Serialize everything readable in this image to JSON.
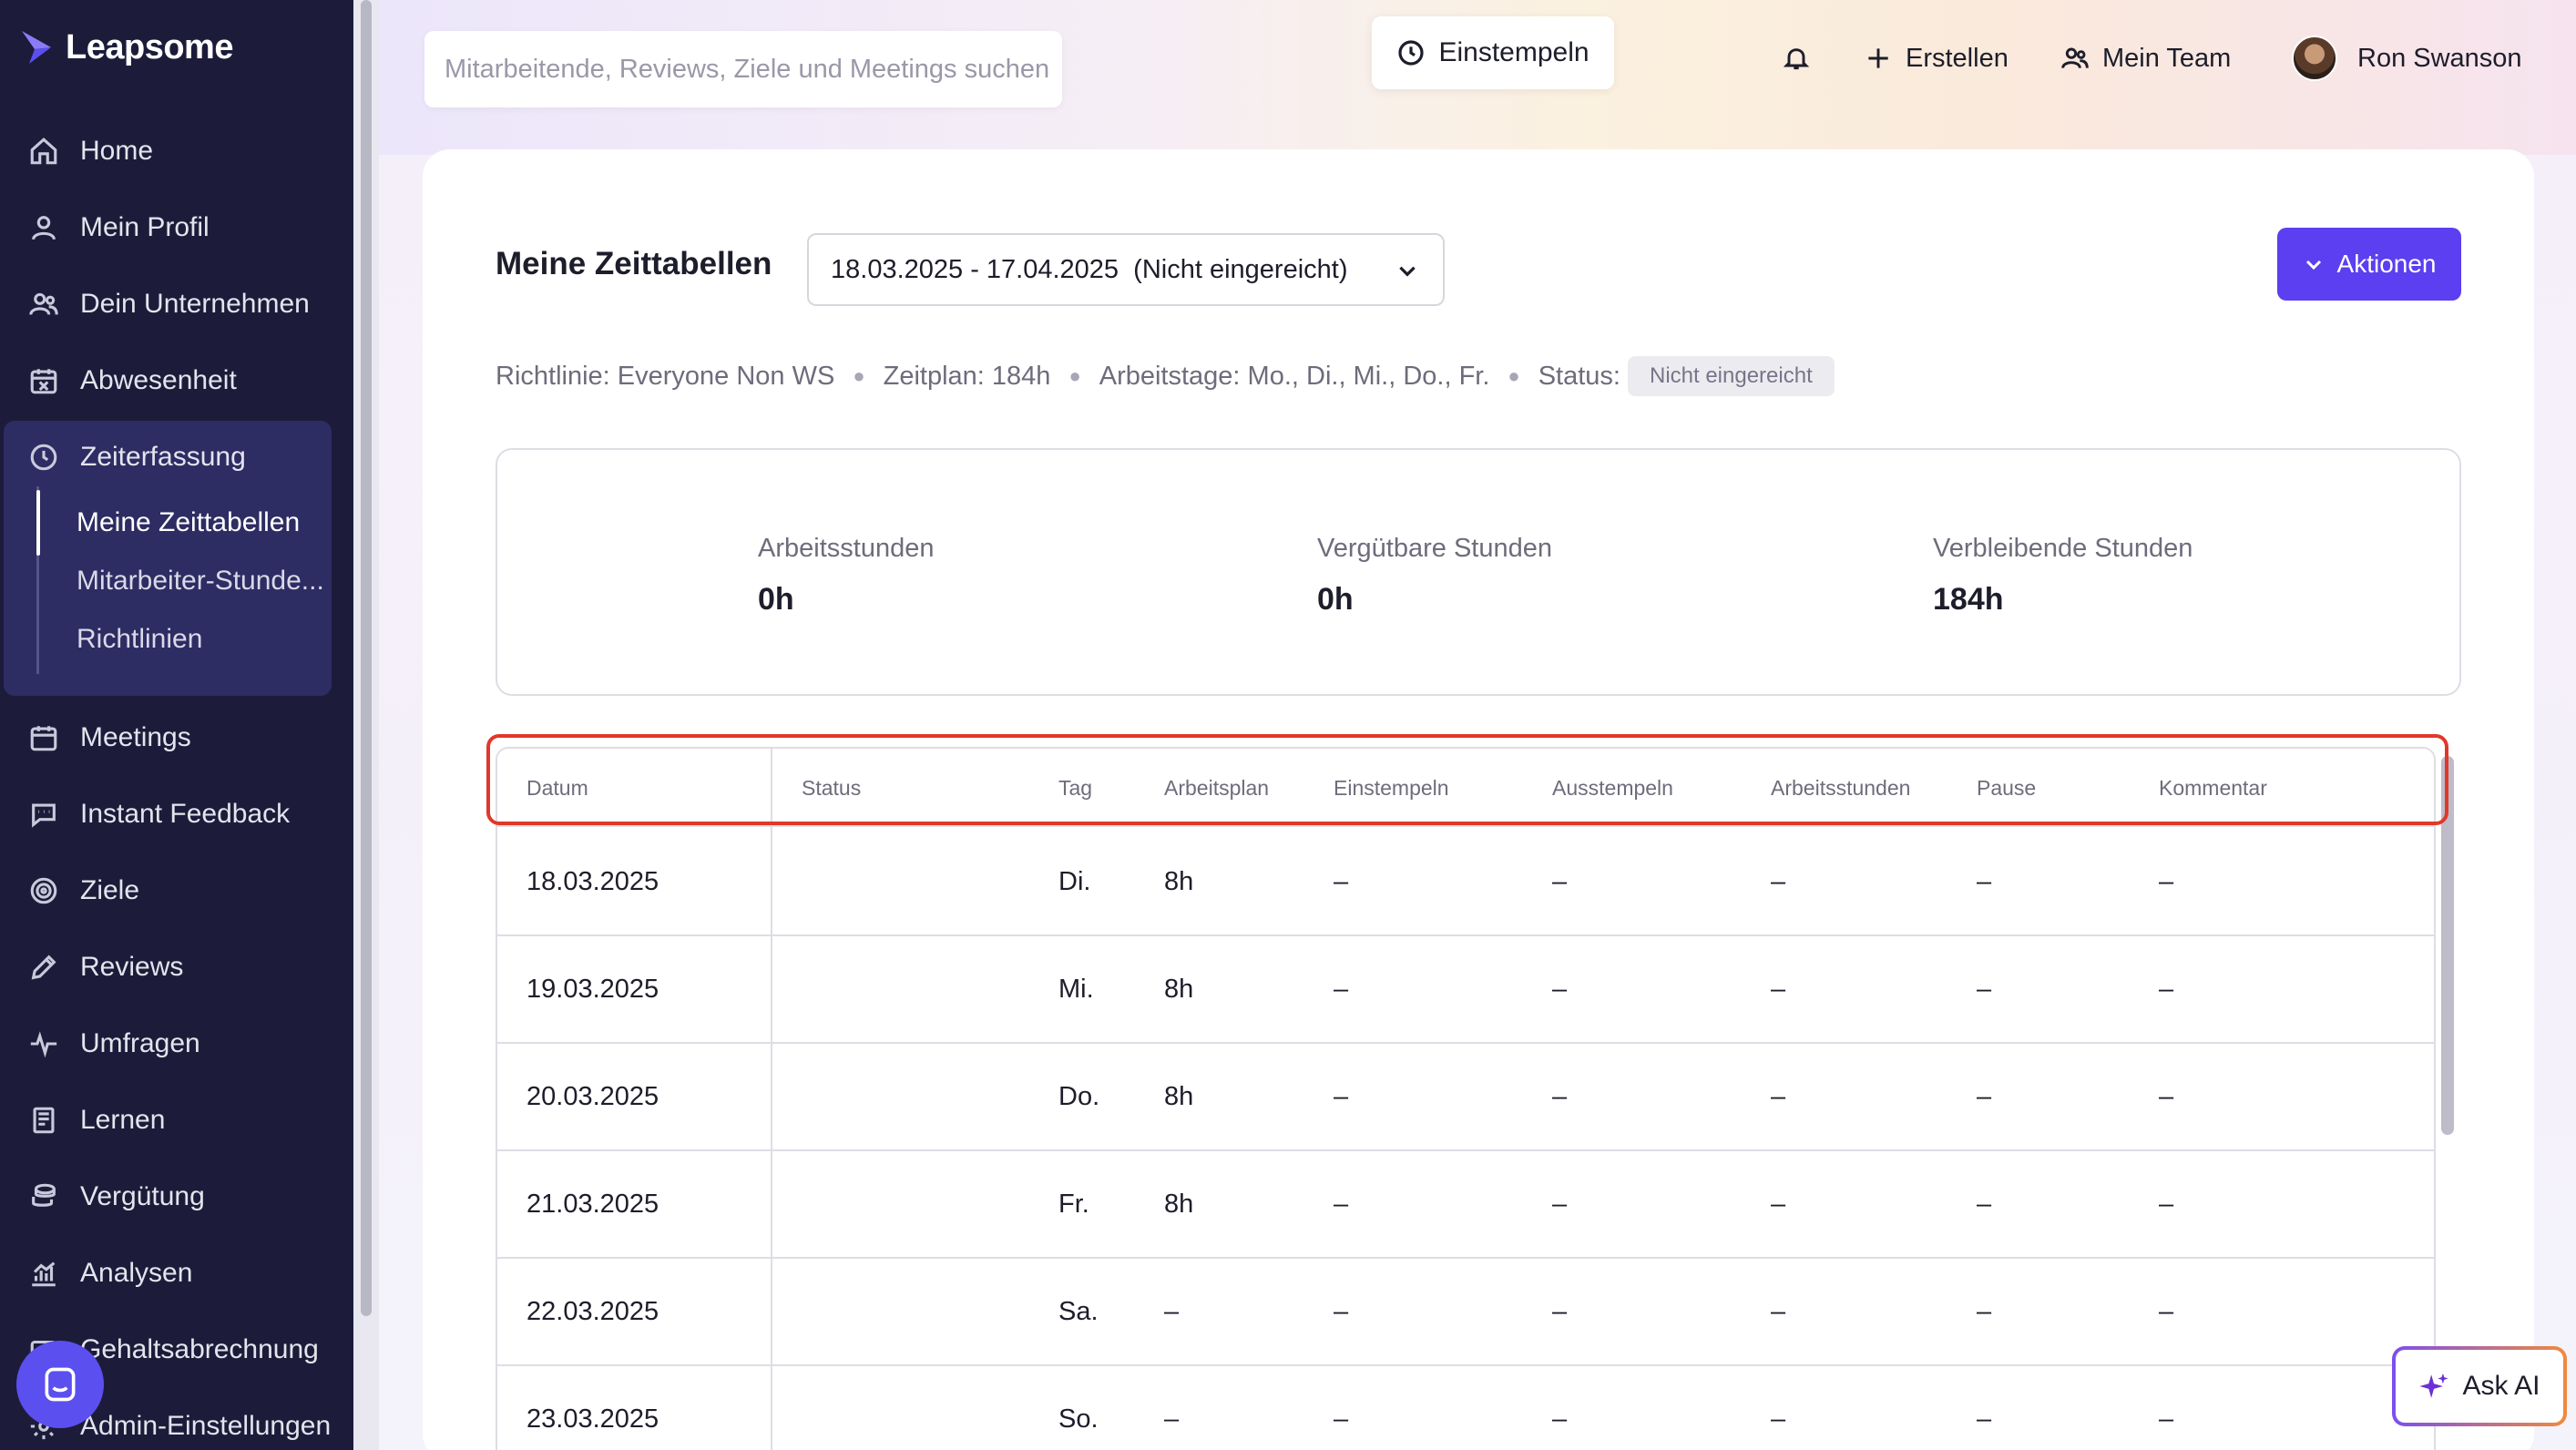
{
  "app": {
    "logo_text": "Leapsome"
  },
  "sidebar": {
    "items": [
      {
        "label": "Home",
        "icon": "home-icon"
      },
      {
        "label": "Mein Profil",
        "icon": "user-icon"
      },
      {
        "label": "Dein Unternehmen",
        "icon": "people-icon"
      },
      {
        "label": "Abwesenheit",
        "icon": "calendar-x-icon"
      },
      {
        "label": "Zeiterfassung",
        "icon": "clock-icon"
      },
      {
        "label": "Meetings",
        "icon": "calendar-icon"
      },
      {
        "label": "Instant Feedback",
        "icon": "chat-icon"
      },
      {
        "label": "Ziele",
        "icon": "target-icon"
      },
      {
        "label": "Reviews",
        "icon": "pencil-icon"
      },
      {
        "label": "Umfragen",
        "icon": "pulse-icon"
      },
      {
        "label": "Lernen",
        "icon": "book-icon"
      },
      {
        "label": "Vergütung",
        "icon": "coins-icon"
      },
      {
        "label": "Analysen",
        "icon": "chart-icon"
      },
      {
        "label": "Gehaltsabrechnung",
        "icon": "payroll-icon"
      },
      {
        "label": "Admin-Einstellungen",
        "icon": "settings-icon"
      }
    ],
    "sub_items": [
      {
        "label": "Meine Zeittabellen",
        "active": true
      },
      {
        "label": "Mitarbeiter-Stunde...",
        "active": false
      },
      {
        "label": "Richtlinien",
        "active": false
      }
    ]
  },
  "topbar": {
    "search_placeholder": "Mitarbeitende, Reviews, Ziele und Meetings suchen",
    "clock_in_label": "Einstempeln",
    "create_label": "Erstellen",
    "team_label": "Mein Team",
    "user_name": "Ron Swanson"
  },
  "page": {
    "title": "Meine Zeittabellen",
    "period_value": "18.03.2025 - 17.04.2025  (Nicht eingereicht)",
    "actions_label": "Aktionen",
    "meta": {
      "policy": "Richtlinie: Everyone Non WS",
      "schedule": "Zeitplan: 184h",
      "workdays": "Arbeitstage: Mo., Di., Mi., Do., Fr.",
      "status_label": "Status:",
      "status_value": "Nicht eingereicht"
    },
    "summary": [
      {
        "label": "Arbeitsstunden",
        "value": "0h"
      },
      {
        "label": "Vergütbare Stunden",
        "value": "0h"
      },
      {
        "label": "Verbleibende Stunden",
        "value": "184h"
      }
    ]
  },
  "table": {
    "headers": [
      "Datum",
      "Status",
      "Tag",
      "Arbeitsplan",
      "Einstempeln",
      "Ausstempeln",
      "Arbeitsstunden",
      "Pause",
      "Kommentar"
    ],
    "rows": [
      [
        "18.03.2025",
        "",
        "Di.",
        "8h",
        "–",
        "–",
        "–",
        "–",
        "–"
      ],
      [
        "19.03.2025",
        "",
        "Mi.",
        "8h",
        "–",
        "–",
        "–",
        "–",
        "–"
      ],
      [
        "20.03.2025",
        "",
        "Do.",
        "8h",
        "–",
        "–",
        "–",
        "–",
        "–"
      ],
      [
        "21.03.2025",
        "",
        "Fr.",
        "8h",
        "–",
        "–",
        "–",
        "–",
        "–"
      ],
      [
        "22.03.2025",
        "",
        "Sa.",
        "–",
        "–",
        "–",
        "–",
        "–",
        "–"
      ],
      [
        "23.03.2025",
        "",
        "So.",
        "–",
        "–",
        "–",
        "–",
        "–",
        "–"
      ]
    ]
  },
  "ask_ai_label": "Ask AI",
  "colors": {
    "sidebar_bg": "#1c1c3a",
    "sidebar_active_group": "#2d2c63",
    "accent": "#5b3ff0",
    "highlight": "#e0382a"
  }
}
